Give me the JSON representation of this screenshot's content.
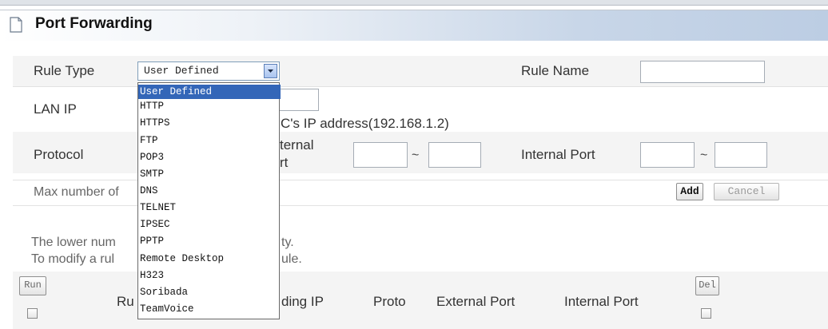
{
  "header": {
    "title": "Port Forwarding"
  },
  "form": {
    "rule_type_label": "Rule Type",
    "rule_type_value": "User Defined",
    "rule_name_label": "Rule Name",
    "lan_ip_label": "LAN IP",
    "lan_ip_hint": "C's IP address(192.168.1.2)",
    "protocol_label": "Protocol",
    "external_port_label_line1": "ternal",
    "external_port_label_line2": "rt",
    "range_separator": "~",
    "internal_port_label": "Internal Port",
    "max_number_text": "Max number of",
    "add_button": "Add",
    "cancel_button": "Cancel"
  },
  "notes": {
    "line1_start": "The lower num",
    "line1_end": "ty.",
    "line2_start": "To modify a rul",
    "line2_end": "ule."
  },
  "table": {
    "run_button": "Run",
    "del_button": "Del",
    "col_rule": "Ru",
    "col_forwarding_ip": "ding IP",
    "col_proto": "Proto",
    "col_external_port": "External Port",
    "col_internal_port": "Internal Port"
  },
  "dropdown": {
    "options": [
      "User Defined",
      "HTTP",
      "HTTPS",
      "FTP",
      "POP3",
      "SMTP",
      "DNS",
      "TELNET",
      "IPSEC",
      "PPTP",
      "Remote Desktop",
      "H323",
      "Soribada",
      "TeamVoice"
    ],
    "selected_index": 0
  },
  "colors": {
    "selected_option": "#3366b8",
    "header_gradient_end": "#bccde3"
  }
}
